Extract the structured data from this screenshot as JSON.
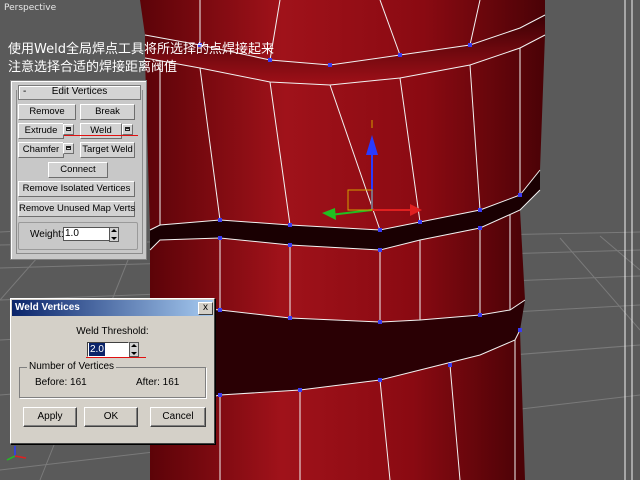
{
  "viewport": {
    "label": "Perspective"
  },
  "captions": {
    "line1": "使用Weld全局焊点工具将所选择的点焊接起来",
    "line2": "注意选择合适的焊接距离阀值"
  },
  "rollout": {
    "collapse_symbol": "-",
    "title": "Edit Vertices",
    "remove_label": "Remove",
    "break_label": "Break",
    "extrude_label": "Extrude",
    "weld_label": "Weld",
    "chamfer_label": "Chamfer",
    "target_weld_label": "Target Weld",
    "connect_label": "Connect",
    "remove_isolated_label": "Remove Isolated Vertices",
    "remove_unused_label": "Remove Unused Map Verts",
    "weight_label": "Weight:",
    "weight_value": "1.0"
  },
  "dialog": {
    "title": "Weld Vertices",
    "close_symbol": "x",
    "threshold_label": "Weld Threshold:",
    "threshold_value": "2.0",
    "group_label": "Number of Vertices",
    "before_text": "Before: 161",
    "after_text": "After: 161",
    "apply_label": "Apply",
    "ok_label": "OK",
    "cancel_label": "Cancel"
  },
  "colors": {
    "mesh_red": "#8a0a10",
    "wire": "#f2f2f2",
    "vertex": "#3a3af0",
    "grid": "#7a7a7a",
    "title_bar": "#0a246a",
    "highlight_underline": "#e01010"
  }
}
